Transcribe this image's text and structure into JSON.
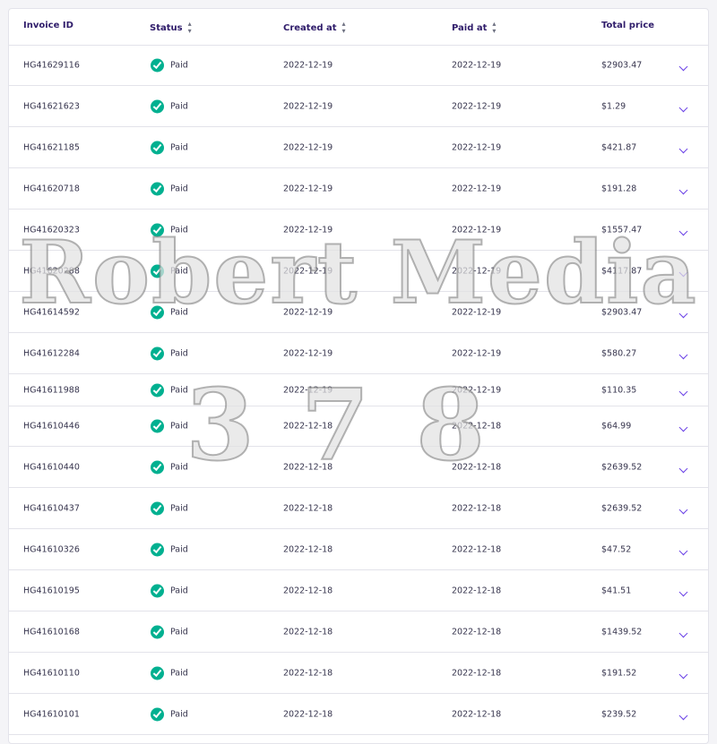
{
  "table": {
    "headers": {
      "invoice_id": "Invoice ID",
      "status": "Status",
      "created_at": "Created at",
      "paid_at": "Paid at",
      "total_price": "Total price"
    },
    "rows": [
      {
        "id": "HG41629116",
        "status": "Paid",
        "created": "2022-12-19",
        "paid": "2022-12-19",
        "total": "$2903.47"
      },
      {
        "id": "HG41621623",
        "status": "Paid",
        "created": "2022-12-19",
        "paid": "2022-12-19",
        "total": "$1.29"
      },
      {
        "id": "HG41621185",
        "status": "Paid",
        "created": "2022-12-19",
        "paid": "2022-12-19",
        "total": "$421.87"
      },
      {
        "id": "HG41620718",
        "status": "Paid",
        "created": "2022-12-19",
        "paid": "2022-12-19",
        "total": "$191.28"
      },
      {
        "id": "HG41620323",
        "status": "Paid",
        "created": "2022-12-19",
        "paid": "2022-12-19",
        "total": "$1557.47"
      },
      {
        "id": "HG41620288",
        "status": "Paid",
        "created": "2022-12-19",
        "paid": "2022-12-19",
        "total": "$4117.87"
      },
      {
        "id": "HG41614592",
        "status": "Paid",
        "created": "2022-12-19",
        "paid": "2022-12-19",
        "total": "$2903.47"
      },
      {
        "id": "HG41612284",
        "status": "Paid",
        "created": "2022-12-19",
        "paid": "2022-12-19",
        "total": "$580.27"
      },
      {
        "id": "HG41611988",
        "status": "Paid",
        "created": "2022-12-19",
        "paid": "2022-12-19",
        "total": "$110.35"
      },
      {
        "id": "HG41610446",
        "status": "Paid",
        "created": "2022-12-18",
        "paid": "2022-12-18",
        "total": "$64.99"
      },
      {
        "id": "HG41610440",
        "status": "Paid",
        "created": "2022-12-18",
        "paid": "2022-12-18",
        "total": "$2639.52"
      },
      {
        "id": "HG41610437",
        "status": "Paid",
        "created": "2022-12-18",
        "paid": "2022-12-18",
        "total": "$2639.52"
      },
      {
        "id": "HG41610326",
        "status": "Paid",
        "created": "2022-12-18",
        "paid": "2022-12-18",
        "total": "$47.52"
      },
      {
        "id": "HG41610195",
        "status": "Paid",
        "created": "2022-12-18",
        "paid": "2022-12-18",
        "total": "$41.51"
      },
      {
        "id": "HG41610168",
        "status": "Paid",
        "created": "2022-12-18",
        "paid": "2022-12-18",
        "total": "$1439.52"
      },
      {
        "id": "HG41610110",
        "status": "Paid",
        "created": "2022-12-18",
        "paid": "2022-12-18",
        "total": "$191.52"
      },
      {
        "id": "HG41610101",
        "status": "Paid",
        "created": "2022-12-18",
        "paid": "2022-12-18",
        "total": "$239.52"
      }
    ]
  },
  "watermark": {
    "line1": "Robert Media",
    "line2": "378"
  },
  "colors": {
    "accent": "#673de6",
    "paid": "#00b090",
    "header_text": "#2f1c6a",
    "border": "#e3e3ea"
  }
}
